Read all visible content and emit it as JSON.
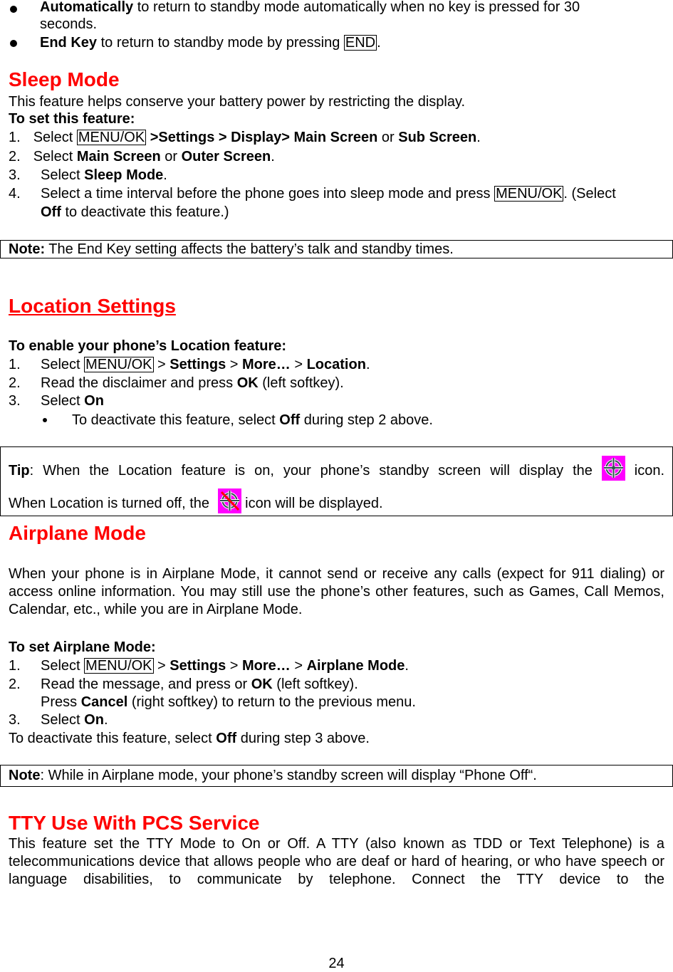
{
  "top_bullets": [
    {
      "bold": "Automatically",
      "text": " to return to standby mode automatically when no key is pressed for 30",
      "continuation": "seconds."
    },
    {
      "bold": "End Key",
      "text_before": " to return to standby mode by pressing ",
      "key": "END",
      "text_after": "."
    }
  ],
  "sleep_mode": {
    "heading": "Sleep Mode",
    "intro": "This feature helps conserve your battery power by restricting the display.",
    "subheading": "To set this feature:",
    "steps": [
      {
        "num": "1.",
        "text1": "Select ",
        "key": "MENU/OK",
        "bold1": " >Settings > Display> Main Screen",
        "text2": " or ",
        "bold2": "Sub Screen",
        "text3": "."
      },
      {
        "num": "2.",
        "text1": "Select ",
        "bold1": "Main Screen",
        "text2": " or ",
        "bold2": "Outer Screen",
        "text3": "."
      },
      {
        "num": "3.",
        "text1": "Select ",
        "bold1": "Sleep Mode",
        "text2": "."
      },
      {
        "num": "4.",
        "text1": "Select a time interval before the phone goes into sleep mode and press ",
        "key": "MENU/OK",
        "text2": ". (Select",
        "bold_cont": "Off",
        "text_cont": " to deactivate this feature.)"
      }
    ],
    "note_label": "Note:",
    "note_text": " The End Key setting affects the battery’s talk and standby times."
  },
  "location": {
    "heading": "Location Settings",
    "subheading": "To enable your phone’s Location feature:",
    "steps": [
      {
        "num": "1.",
        "text1": "Select ",
        "key": "MENU/OK",
        "text2": " > ",
        "bold1": "Settings",
        "text3": " > ",
        "bold2": "More…",
        "text4": " > ",
        "bold3": "Location",
        "text5": "."
      },
      {
        "num": "2.",
        "text1": "Read the disclaimer and press ",
        "bold1": "OK",
        "text2": " (left softkey)."
      },
      {
        "num": "3.",
        "text1": "Select ",
        "bold1": "On"
      }
    ],
    "sub_bullet": {
      "text1": "To deactivate this feature, select ",
      "bold1": "Off",
      "text2": " during step 2 above."
    },
    "tip": {
      "label": "Tip",
      "text1": ": When the Location feature is on, your phone’s standby screen will display the ",
      "icon_on": "location-on-icon",
      "text2": " icon.",
      "text3": "When Location is turned off, the ",
      "icon_off": "location-off-icon",
      "text4": " icon will be displayed."
    }
  },
  "airplane": {
    "heading": "Airplane Mode",
    "intro": "When your phone is in Airplane Mode, it cannot send or receive any calls (expect for 911 dialing) or access online information. You may still use the phone’s other features, such as Games, Call Memos, Calendar, etc., while you are in Airplane Mode.",
    "subheading": "To set Airplane Mode:",
    "steps": [
      {
        "num": "1.",
        "text1": "Select ",
        "key": "MENU/OK",
        "text2": " > ",
        "bold1": "Settings",
        "text3": " > ",
        "bold2": "More…",
        "text4": " > ",
        "bold3": "Airplane Mode",
        "text5": "."
      },
      {
        "num": "2.",
        "text1": "Read the message, and press or ",
        "bold1": "OK",
        "text2": " (left softkey).",
        "line2_text1": "Press ",
        "line2_bold": "Cancel",
        "line2_text2": " (right softkey) to return to the previous menu."
      },
      {
        "num": "3.",
        "text1": "Select ",
        "bold1": "On",
        "text2": "."
      }
    ],
    "deactivate": {
      "text1": "To deactivate this feature, select ",
      "bold1": "Off",
      "text2": " during step 3 above."
    },
    "note_label": "Note",
    "note_text": ": While in Airplane mode, your phone’s standby screen will display “Phone Off“."
  },
  "tty": {
    "heading": "TTY Use With PCS Service",
    "body": "This feature set the TTY Mode to On or Off. A TTY (also known as TDD or Text Telephone) is a telecommunications device that allows people who are deaf or hard of hearing, or who have speech or language disabilities, to communicate by telephone. Connect the TTY device to the"
  },
  "page_number": "24",
  "colors": {
    "heading": "#ff0000",
    "icon_bg": "#ff00ff",
    "icon_stroke": "#2f4f4f",
    "icon_slash": "#ff0000"
  }
}
